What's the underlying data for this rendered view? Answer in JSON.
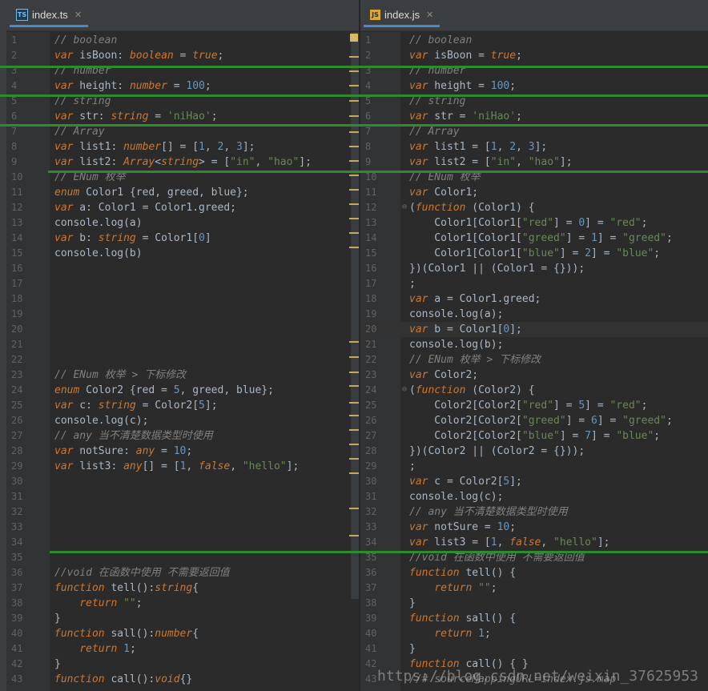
{
  "tabs": {
    "left": {
      "icon": "TS",
      "label": "index.ts",
      "close": "✕"
    },
    "right": {
      "icon": "JS",
      "label": "index.js",
      "close": "✕"
    }
  },
  "ts_lines": [
    "// boolean",
    "var isBoon: boolean = true;",
    "// number",
    "var height: number = 100;",
    "// string",
    "var str: string = 'niHao';",
    "// Array",
    "var list1: number[] = [1, 2, 3];",
    "var list2: Array<string> = [\"in\", \"hao\"];",
    "// ENum 枚举",
    "enum Color1 {red, greed, blue};",
    "var a: Color1 = Color1.greed;",
    "console.log(a)",
    "var b: string = Color1[0]",
    "console.log(b)",
    "",
    "",
    "",
    "",
    "",
    "",
    "",
    "// ENum 枚举 > 下标修改",
    "enum Color2 {red = 5, greed, blue};",
    "var c: string = Color2[5];",
    "console.log(c);",
    "// any 当不清楚数据类型时使用",
    "var notSure: any = 10;",
    "var list3: any[] = [1, false, \"hello\"];",
    "",
    "",
    "",
    "",
    "",
    "",
    "//void 在函数中使用 不需要返回值",
    "function tell():string{",
    "    return \"\";",
    "}",
    "function sall():number{",
    "    return 1;",
    "}",
    "function call():void{}"
  ],
  "js_lines": [
    "// boolean",
    "var isBoon = true;",
    "// number",
    "var height = 100;",
    "// string",
    "var str = 'niHao';",
    "// Array",
    "var list1 = [1, 2, 3];",
    "var list2 = [\"in\", \"hao\"];",
    "// ENum 枚举",
    "var Color1;",
    "(function (Color1) {",
    "    Color1[Color1[\"red\"] = 0] = \"red\";",
    "    Color1[Color1[\"greed\"] = 1] = \"greed\";",
    "    Color1[Color1[\"blue\"] = 2] = \"blue\";",
    "})(Color1 || (Color1 = {}));",
    ";",
    "var a = Color1.greed;",
    "console.log(a);",
    "var b = Color1[0];",
    "console.log(b);",
    "// ENum 枚举 > 下标修改",
    "var Color2;",
    "(function (Color2) {",
    "    Color2[Color2[\"red\"] = 5] = \"red\";",
    "    Color2[Color2[\"greed\"] = 6] = \"greed\";",
    "    Color2[Color2[\"blue\"] = 7] = \"blue\";",
    "})(Color2 || (Color2 = {}));",
    ";",
    "var c = Color2[5];",
    "console.log(c);",
    "// any 当不清楚数据类型时使用",
    "var notSure = 10;",
    "var list3 = [1, false, \"hello\"];",
    "//void 在函数中使用 不需要返回值",
    "function tell() {",
    "    return \"\";",
    "}",
    "function sall() {",
    "    return 1;",
    "}",
    "function call() { }",
    "//# sourceMappingURL=index.js.map"
  ],
  "watermark": "https://blog.csdn.net/weixin_37625953",
  "colors": {
    "keyword": "#cc7832",
    "string": "#6a8759",
    "number": "#6897bb",
    "comment": "#808080",
    "text": "#a9b7c6",
    "diff": "#2e8b2e"
  }
}
